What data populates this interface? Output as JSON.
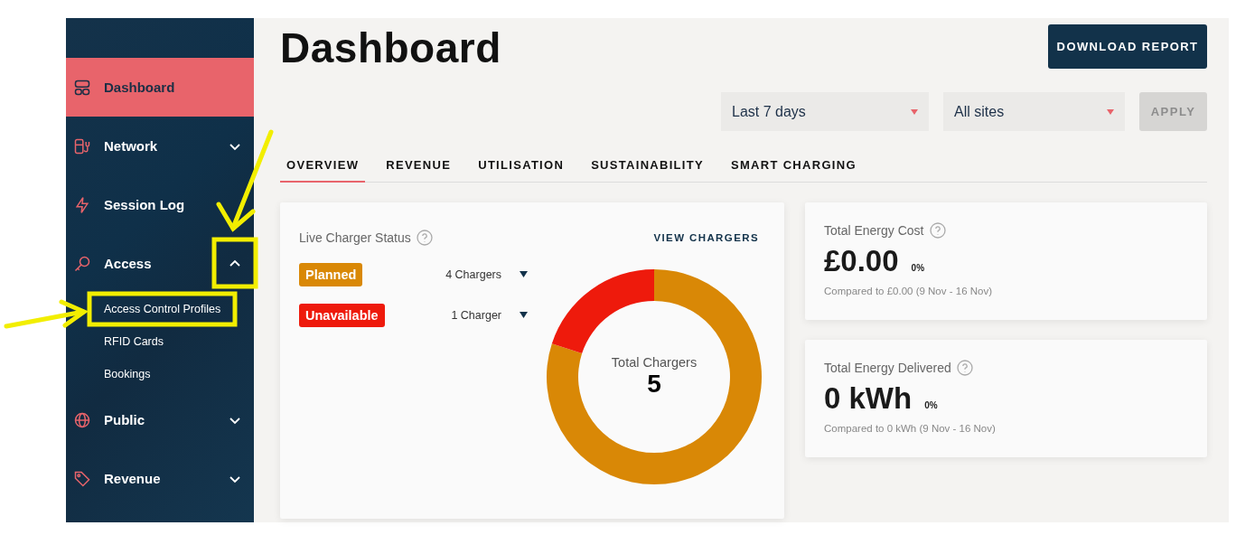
{
  "sidebar": {
    "items": [
      {
        "label": "Dashboard",
        "kind": "link",
        "selected": true
      },
      {
        "label": "Network",
        "kind": "group",
        "selected": false,
        "expanded": false
      },
      {
        "label": "Session Log",
        "kind": "link",
        "selected": false
      },
      {
        "label": "Access",
        "kind": "group",
        "selected": false,
        "expanded": true,
        "children": [
          {
            "label": "Access Control Profiles"
          },
          {
            "label": "RFID Cards"
          },
          {
            "label": "Bookings"
          }
        ]
      },
      {
        "label": "Public",
        "kind": "group",
        "selected": false,
        "expanded": false
      },
      {
        "label": "Revenue",
        "kind": "group",
        "selected": false,
        "expanded": false
      }
    ]
  },
  "header": {
    "title": "Dashboard",
    "download_button": "DOWNLOAD REPORT"
  },
  "filters": {
    "period": "Last 7 days",
    "site": "All sites",
    "apply_button": "APPLY",
    "apply_disabled": true
  },
  "tabs": [
    {
      "label": "OVERVIEW",
      "selected": true
    },
    {
      "label": "REVENUE",
      "selected": false
    },
    {
      "label": "UTILISATION",
      "selected": false
    },
    {
      "label": "SUSTAINABILITY",
      "selected": false
    },
    {
      "label": "SMART CHARGING",
      "selected": false
    }
  ],
  "charger_status": {
    "title": "Live Charger Status",
    "link": "VIEW CHARGERS",
    "statuses": [
      {
        "count": "4 Chargers",
        "color": "#d98806"
      },
      {
        "count": "1 Charger",
        "color": "#ee1a0c"
      }
    ],
    "center_label": "Total Chargers",
    "center_value": "5",
    "chart_data": {
      "type": "donut",
      "categories": [
        "Planned",
        "Unavailable"
      ],
      "values": [
        80,
        20
      ]
    }
  },
  "metrics": [
    {
      "title": "Total Energy Cost",
      "value": "£0.00",
      "change": "0%",
      "comparison": "Compared to £0.00 (9 Nov - 16 Nov)"
    },
    {
      "title": "Total Energy Delivered",
      "value": "0 kWh",
      "change": "0%",
      "comparison": "Compared to 0 kWh (9 Nov - 16 Nov)"
    }
  ]
}
